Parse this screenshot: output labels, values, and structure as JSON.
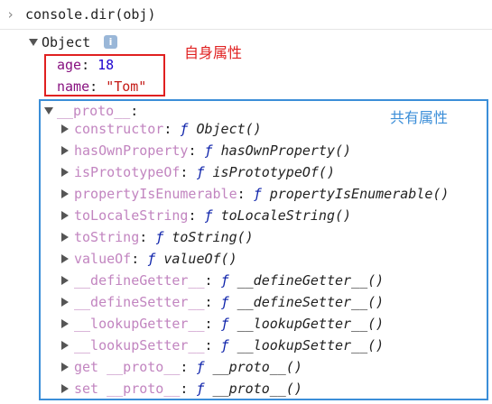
{
  "console": {
    "command": "console.dir(obj)",
    "object_label": "Object",
    "info_badge": "i"
  },
  "own_props": [
    {
      "key": "age",
      "sep": ": ",
      "value": "18"
    },
    {
      "key": "name",
      "sep": ": ",
      "value": "\"Tom\""
    }
  ],
  "annotations": {
    "own": "自身属性",
    "shared": "共有属性"
  },
  "colors": {
    "own_box": "#e02020",
    "shared_box": "#3b8ed8",
    "own_annotation": "#e02020",
    "shared_annotation": "#3b8ed8"
  },
  "proto": {
    "label": "__proto__",
    "sep": ":",
    "items": [
      {
        "key": "constructor",
        "sep": ": ",
        "f": "ƒ",
        "fn": "Object()"
      },
      {
        "key": "hasOwnProperty",
        "sep": ": ",
        "f": "ƒ",
        "fn": "hasOwnProperty()"
      },
      {
        "key": "isPrototypeOf",
        "sep": ": ",
        "f": "ƒ",
        "fn": "isPrototypeOf()"
      },
      {
        "key": "propertyIsEnumerable",
        "sep": ": ",
        "f": "ƒ",
        "fn": "propertyIsEnumerable()"
      },
      {
        "key": "toLocaleString",
        "sep": ": ",
        "f": "ƒ",
        "fn": "toLocaleString()"
      },
      {
        "key": "toString",
        "sep": ": ",
        "f": "ƒ",
        "fn": "toString()"
      },
      {
        "key": "valueOf",
        "sep": ": ",
        "f": "ƒ",
        "fn": "valueOf()"
      },
      {
        "key": "__defineGetter__",
        "sep": ": ",
        "f": "ƒ",
        "fn": "__defineGetter__()"
      },
      {
        "key": "__defineSetter__",
        "sep": ": ",
        "f": "ƒ",
        "fn": "__defineSetter__()"
      },
      {
        "key": "__lookupGetter__",
        "sep": ": ",
        "f": "ƒ",
        "fn": "__lookupGetter__()"
      },
      {
        "key": "__lookupSetter__",
        "sep": ": ",
        "f": "ƒ",
        "fn": "__lookupSetter__()"
      },
      {
        "key": "get __proto__",
        "sep": ": ",
        "f": "ƒ",
        "fn": "__proto__()"
      },
      {
        "key": "set __proto__",
        "sep": ": ",
        "f": "ƒ",
        "fn": "__proto__()"
      }
    ]
  }
}
